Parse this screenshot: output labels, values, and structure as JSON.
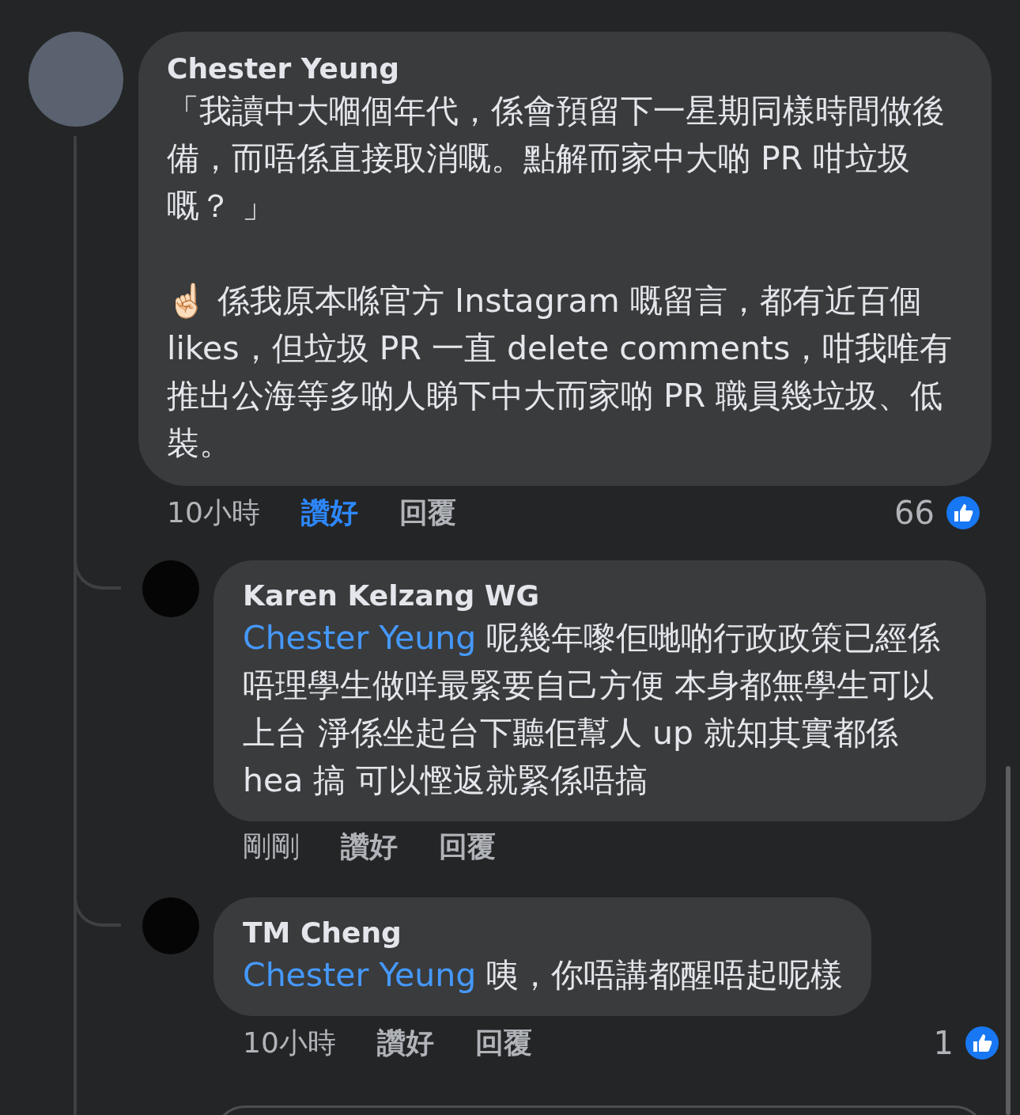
{
  "comment": {
    "author": "Chester Yeung",
    "paragraphs": [
      "「我讀中大嗰個年代，係會預留下一星期同樣時間做後備，而唔係直接取消嘅。點解而家中大啲 PR 咁垃圾嘅？ 」",
      "☝🏻 係我原本喺官方 Instagram 嘅留言，都有近百個 likes，但垃圾 PR 一直 delete comments，咁我唯有推出公海等多啲人睇下中大而家啲 PR 職員幾垃圾、低裝。"
    ],
    "time": "10小時",
    "like_label": "讚好",
    "liked": true,
    "reply_label": "回覆",
    "reaction_count": "66"
  },
  "replies": [
    {
      "author": "Karen Kelzang WG",
      "mention": "Chester Yeung",
      "text": "呢幾年嚟佢哋啲行政政策已經係唔理學生做咩最緊要自己方便 本身都無學生可以上台 淨係坐起台下聽佢幫人 up 就知其實都係 hea 搞 可以慳返就緊係唔搞",
      "time": "剛剛",
      "like_label": "讚好",
      "liked": false,
      "reply_label": "回覆"
    },
    {
      "author": "TM Cheng",
      "mention": "Chester Yeung",
      "text": "咦，你唔講都醒唔起呢樣",
      "time": "10小時",
      "like_label": "讚好",
      "liked": false,
      "reply_label": "回覆",
      "reaction_count": "1"
    }
  ]
}
